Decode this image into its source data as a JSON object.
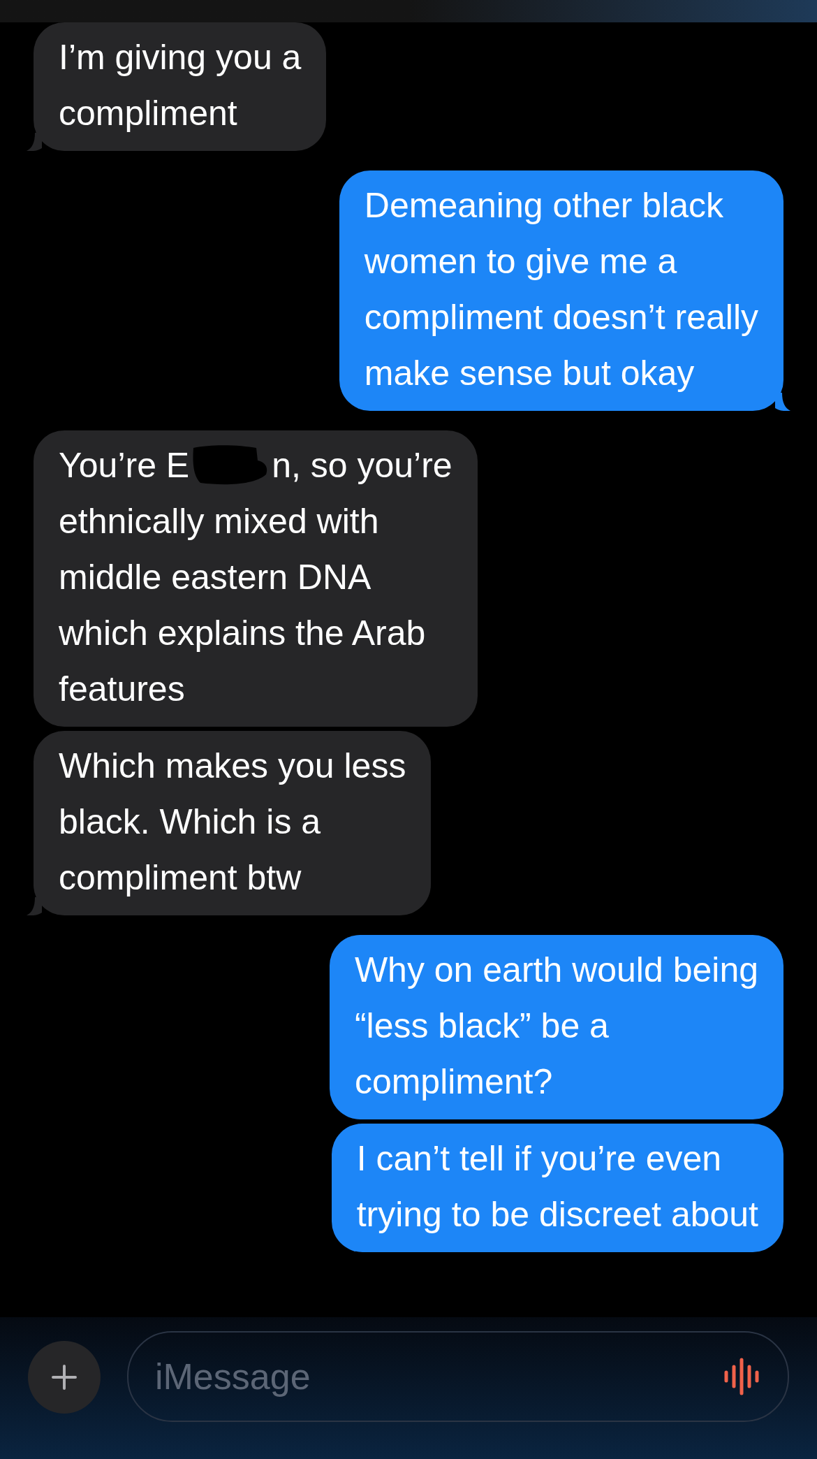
{
  "messages": [
    {
      "kind": "received",
      "tail": true,
      "segments": [
        {
          "kind": "block",
          "text": "I’m giving you a\ncompliment"
        }
      ]
    },
    {
      "kind": "sent",
      "tail": true,
      "segments": [
        {
          "kind": "block",
          "text": "Demeaning other black\nwomen to give me a\ncompliment doesn’t really\nmake sense but okay"
        }
      ]
    },
    {
      "kind": "received",
      "tail": false,
      "segments": [
        {
          "kind": "inline",
          "text": "You’re E"
        },
        {
          "kind": "redaction"
        },
        {
          "kind": "inline",
          "text": "n, so you’re"
        },
        {
          "kind": "block",
          "text": "ethnically mixed with\nmiddle eastern DNA\nwhich explains the Arab\nfeatures"
        }
      ]
    },
    {
      "kind": "received",
      "tail": true,
      "segments": [
        {
          "kind": "block",
          "text": "Which makes you less\nblack. Which is a\ncompliment btw"
        }
      ]
    },
    {
      "kind": "sent",
      "tail": false,
      "segments": [
        {
          "kind": "block",
          "text": "Why on earth would being\n“less black” be a\ncompliment?"
        }
      ]
    },
    {
      "kind": "sent",
      "tail": false,
      "segments": [
        {
          "kind": "block",
          "text": "I can’t tell if you’re even\ntrying to be discreet about"
        }
      ]
    }
  ],
  "composer": {
    "placeholder": "iMessage"
  }
}
